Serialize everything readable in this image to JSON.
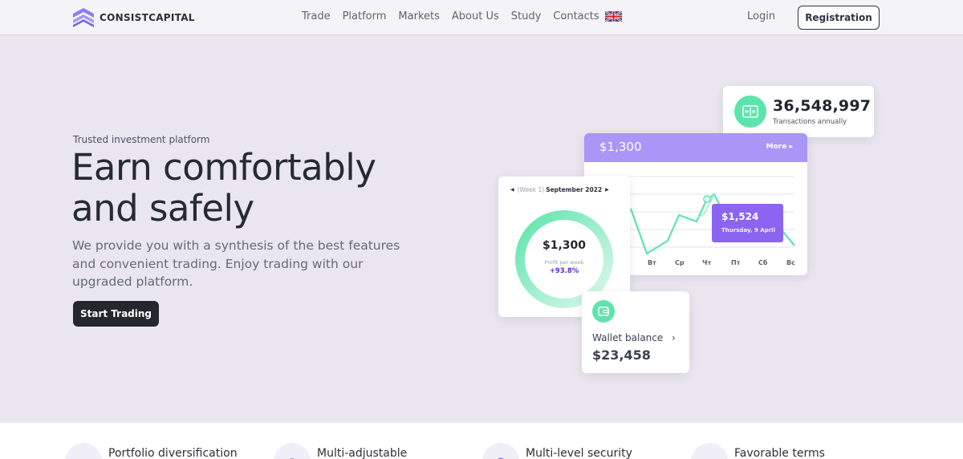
{
  "brand": {
    "name": "CONSISTCAPITAL"
  },
  "nav": {
    "items": [
      "Trade",
      "Platform",
      "Markets",
      "About Us",
      "Study",
      "Contacts"
    ],
    "language_icon": "uk-flag-icon"
  },
  "auth": {
    "login_label": "Login",
    "registration_label": "Registration"
  },
  "hero": {
    "eyebrow": "Trusted investment platform",
    "headline_line1": "Earn comfortably",
    "headline_line2": "and safely",
    "subtext": "We provide you with a synthesis of the best features and convenient trading. Enjoy trading with our upgraded platform.",
    "cta_label": "Start Trading"
  },
  "transactions_card": {
    "value": "36,548,997",
    "label": "Transactions annually",
    "icon": "exchange-icon"
  },
  "chart_card": {
    "amount": "$1,300",
    "more_label": "More",
    "days": [
      "Вт",
      "Ср",
      "Чт",
      "Пт",
      "Сб",
      "Вс"
    ],
    "tooltip_value": "$1,524",
    "tooltip_date": "Thursday, 9 April"
  },
  "profit_card": {
    "week_label": "(Week 1)",
    "month_label": "September 2022",
    "value": "$1,300",
    "label": "Profit per week",
    "change": "+93.8%"
  },
  "wallet_card": {
    "label": "Wallet balance",
    "value": "$23,458",
    "icon": "wallet-icon"
  },
  "features": [
    {
      "title": "Portfolio diversification",
      "icon": "diversification-icon"
    },
    {
      "title": "Multi-adjustable",
      "icon": "globe-icon"
    },
    {
      "title": "Multi-level security",
      "icon": "shield-icon"
    },
    {
      "title": "Favorable terms",
      "icon": "sliders-icon"
    }
  ],
  "colors": {
    "accent_purple": "#a897f7",
    "tooltip_purple": "#8b64f2",
    "accent_green": "#5de4ac",
    "dark": "#24272e",
    "background": "#e9e6ef"
  }
}
